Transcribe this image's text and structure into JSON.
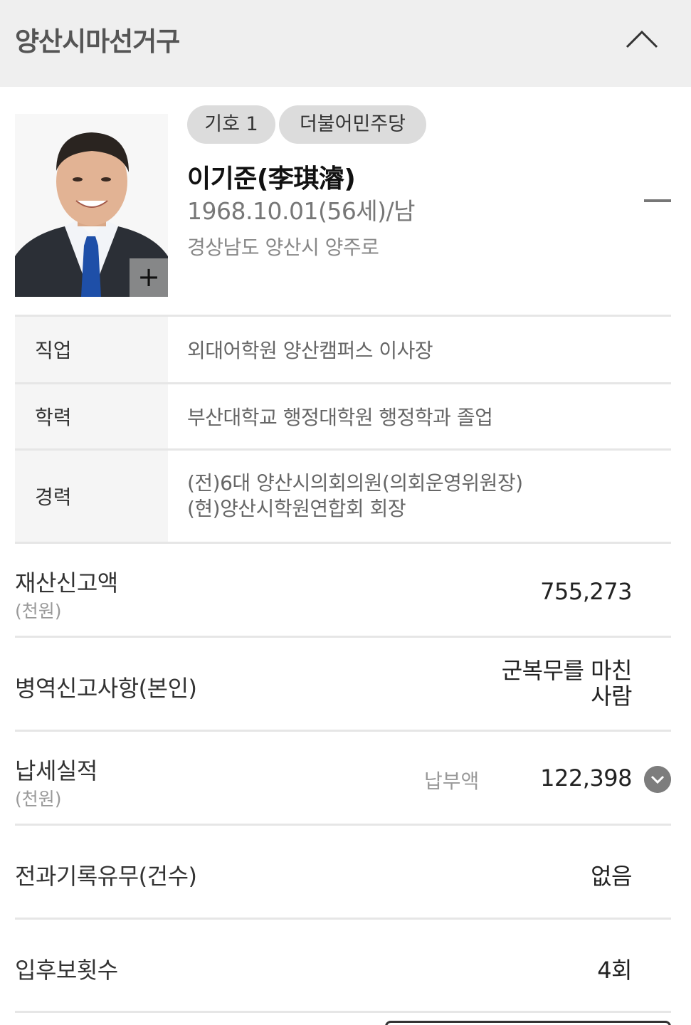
{
  "header": {
    "title": "양산시마선거구"
  },
  "candidate": {
    "number_badge": "기호 1",
    "party_badge": "더불어민주당",
    "name": "이기준(李琪濬)",
    "birth": "1968.10.01(56세)/남",
    "address": "경상남도 양산시 양주로",
    "photo_plus": "+"
  },
  "info": {
    "job_label": "직업",
    "job_value": "외대어학원 양산캠퍼스 이사장",
    "edu_label": "학력",
    "edu_value": "부산대학교 행정대학원 행정학과 졸업",
    "career_label": "경력",
    "career_line1": "(전)6대 양산시의회의원(의회운영위원장)",
    "career_line2": "(현)양산시학원연합회 회장"
  },
  "stats": {
    "property_label": "재산신고액",
    "property_unit": "(천원)",
    "property_value": "755,273",
    "military_label": "병역신고사항(본인)",
    "military_line1": "군복무를 마친",
    "military_line2": "사람",
    "tax_label": "납세실적",
    "tax_unit": "(천원)",
    "tax_mid": "납부액",
    "tax_value": "122,398",
    "criminal_label": "전과기록유무(건수)",
    "criminal_value": "없음",
    "candidacy_label": "입후보횟수",
    "candidacy_value": "4회"
  },
  "colors": {
    "header_bg": "#efefef",
    "badge_bg": "#dcdcdc",
    "label_bg": "#f5f5f5",
    "tie": "#1e4fa8"
  }
}
